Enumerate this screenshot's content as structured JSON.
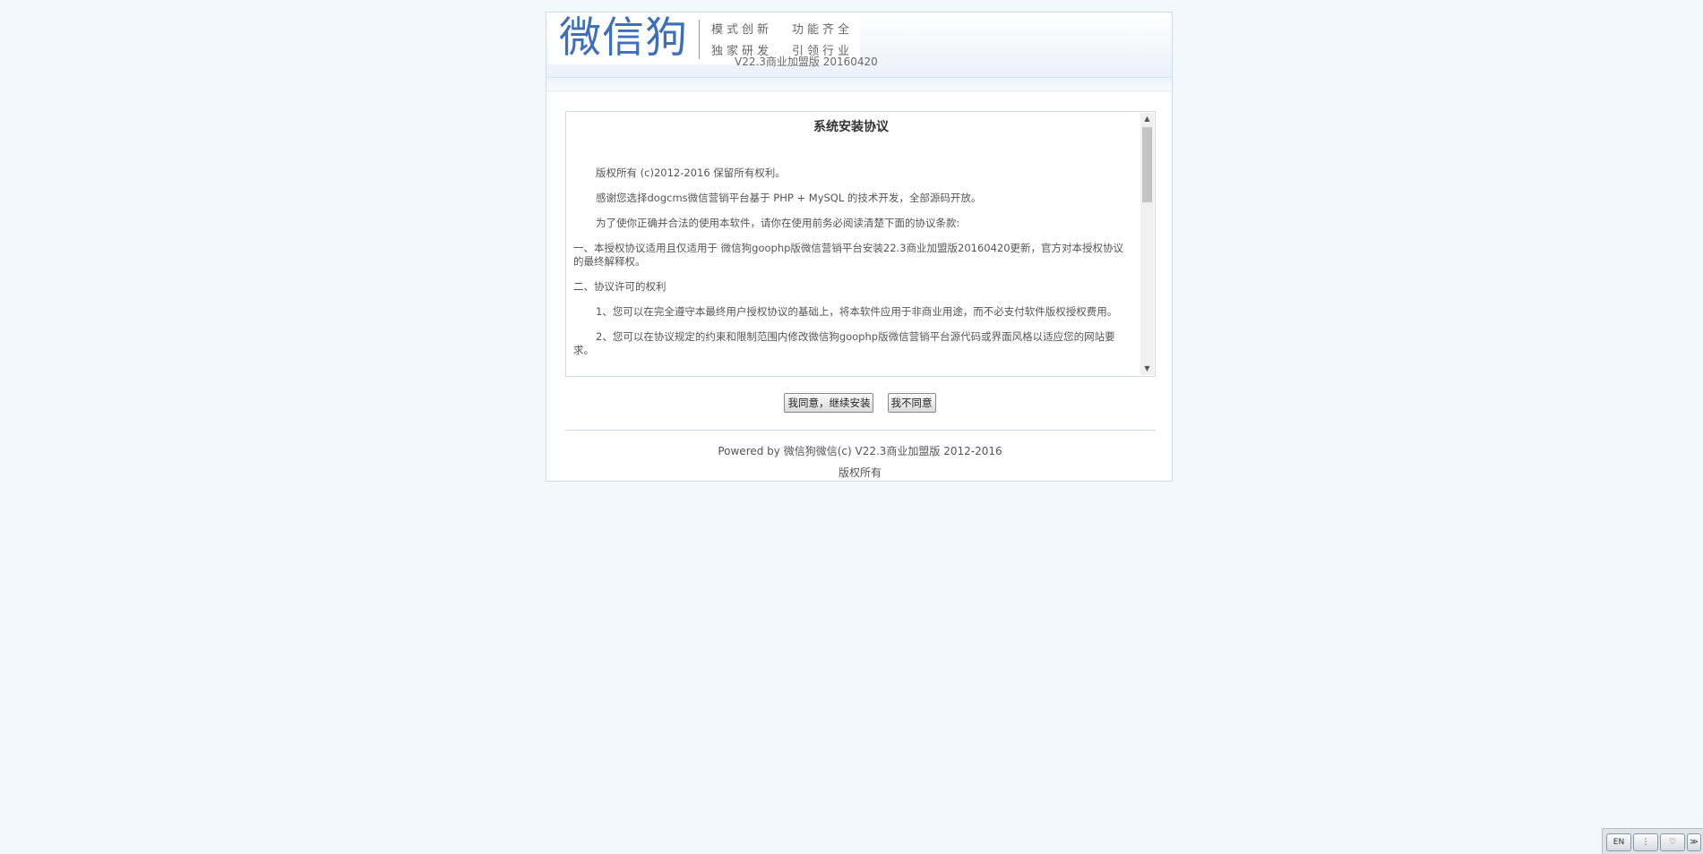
{
  "header": {
    "logo_text": "微信狗",
    "slogans": [
      "模式创新",
      "功能齐全",
      "独家研发",
      "引领行业"
    ],
    "version": "V22.3商业加盟版 20160420"
  },
  "agreement": {
    "title": "系统安装协议",
    "paragraphs": [
      "版权所有 (c)2012-2016 保留所有权利。",
      "感谢您选择dogcms微信营销平台基于 PHP + MySQL 的技术开发，全部源码开放。",
      "为了使你正确并合法的使用本软件，请你在使用前务必阅读清楚下面的协议条款:",
      "一、本授权协议适用且仅适用于 微信狗goophp版微信营销平台安装22.3商业加盟版20160420更新，官方对本授权协议的最终解释权。",
      "二、协议许可的权利",
      "1、您可以在完全遵守本最终用户授权协议的基础上，将本软件应用于非商业用途，而不必支付软件版权授权费用。",
      "2、您可以在协议规定的约束和限制范围内修改微信狗goophp版微信营销平台源代码或界面风格以适应您的网站要求。"
    ]
  },
  "buttons": {
    "agree": "我同意，继续安装",
    "disagree": "我不同意"
  },
  "footer": {
    "powered": "Powered by 微信狗微信(c) V22.3商业加盟版 2012-2016",
    "rights": "版权所有"
  },
  "tray": {
    "lang": "EN",
    "items": [
      "EN",
      "⋮",
      "♡",
      "≫"
    ]
  }
}
